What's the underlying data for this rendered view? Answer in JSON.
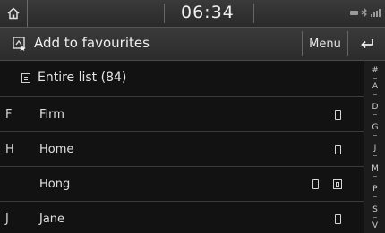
{
  "status_bar": {
    "time": "06:34",
    "icons": [
      "home-icon",
      "battery-icon",
      "bluetooth-icon",
      "signal-icon"
    ]
  },
  "title_bar": {
    "title": "Add to favourites",
    "menu_label": "Menu",
    "icons": [
      "add-favourite-icon",
      "back-icon"
    ]
  },
  "list": {
    "entire_list_label": "Entire list (84)",
    "entries": [
      {
        "initial": "F",
        "name": "Firm",
        "icons": [
          "phone-icon"
        ]
      },
      {
        "initial": "H",
        "name": "Home",
        "icons": [
          "phone-icon"
        ]
      },
      {
        "initial": "",
        "name": "Hong",
        "icons": [
          "phone-icon",
          "sim-icon"
        ]
      },
      {
        "initial": "J",
        "name": "Jane",
        "icons": [
          "phone-icon"
        ]
      }
    ]
  },
  "index_bar": {
    "letters": [
      "#",
      "A",
      "D",
      "G",
      "J",
      "M",
      "P",
      "S",
      "V"
    ]
  },
  "colors": {
    "background": "#121212",
    "bar": "#333333",
    "text": "#e8e8e8"
  }
}
